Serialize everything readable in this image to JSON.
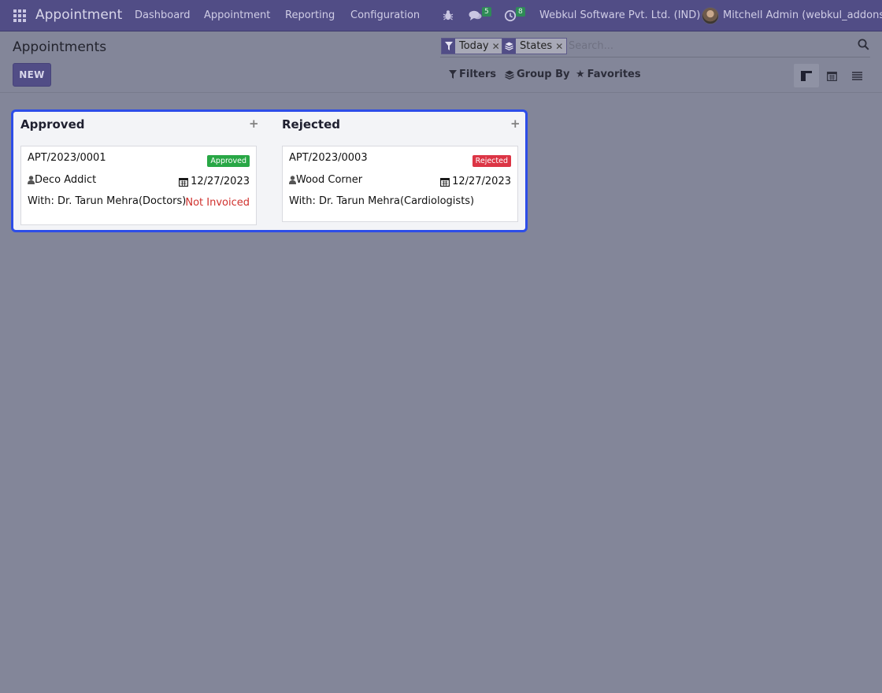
{
  "navbar": {
    "brand": "Appointment",
    "menu": [
      "Dashboard",
      "Appointment",
      "Reporting",
      "Configuration"
    ],
    "messages_count": "5",
    "activities_count": "8",
    "company": "Webkul Software Pvt. Ltd. (IND)",
    "user": "Mitchell Admin (webkul_addons)"
  },
  "control_panel": {
    "title": "Appointments",
    "new_label": "NEW",
    "facets": [
      {
        "label": "Today",
        "icon": "filter-icon"
      },
      {
        "label": "States",
        "icon": "layers-icon"
      }
    ],
    "search_placeholder": "Search...",
    "filters_label": "Filters",
    "group_by_label": "Group By",
    "favorites_label": "Favorites",
    "views": [
      "kanban-view-icon",
      "calendar-view-icon",
      "list-view-icon"
    ],
    "active_view": "kanban"
  },
  "kanban": {
    "columns": [
      {
        "title": "Approved",
        "cards": [
          {
            "ref": "APT/2023/0001",
            "state": "Approved",
            "state_color": "#28a745",
            "customer": "Deco Addict",
            "date": "12/27/2023",
            "with_prefix": "With: Dr. Tarun Mehra",
            "with_group": "(Doctors)",
            "invoice_status": "Not Invoiced"
          }
        ]
      },
      {
        "title": "Rejected",
        "cards": [
          {
            "ref": "APT/2023/0003",
            "state": "Rejected",
            "state_color": "#dc3545",
            "customer": "Wood Corner",
            "date": "12/27/2023",
            "with_prefix": "With: Dr. Tarun Mehra",
            "with_group": "(Cardiologists)"
          }
        ]
      }
    ]
  },
  "colors": {
    "navbar": "#514d86",
    "backdrop": "#838699",
    "highlight_border": "#2d4de8",
    "not_invoiced": "#d0312d"
  }
}
